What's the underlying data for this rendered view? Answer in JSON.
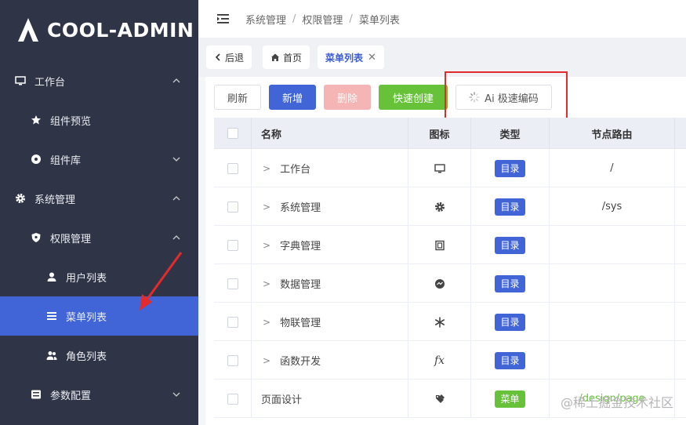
{
  "brand": {
    "name": "COOL-ADMIN"
  },
  "sidebar": {
    "items": [
      {
        "label": "工作台",
        "icon": "monitor-icon",
        "chevron": "up"
      },
      {
        "label": "组件预览",
        "icon": "star-icon"
      },
      {
        "label": "组件库",
        "icon": "disc-icon",
        "chevron": "down"
      },
      {
        "label": "系统管理",
        "icon": "gear-icon",
        "chevron": "up"
      },
      {
        "label": "权限管理",
        "icon": "shield-icon",
        "chevron": "up"
      },
      {
        "label": "用户列表",
        "icon": "user-icon"
      },
      {
        "label": "菜单列表",
        "icon": "menu-icon",
        "active": true
      },
      {
        "label": "角色列表",
        "icon": "users-icon"
      },
      {
        "label": "参数配置",
        "icon": "config-icon",
        "chevron": "down"
      }
    ]
  },
  "header": {
    "breadcrumb": [
      "系统管理",
      "权限管理",
      "菜单列表"
    ]
  },
  "tabs": {
    "back": "后退",
    "home": "首页",
    "current": "菜单列表"
  },
  "toolbar": {
    "refresh": "刷新",
    "add": "新增",
    "delete": "删除",
    "quick_create": "快速创建",
    "ai": "Ai 极速编码"
  },
  "table": {
    "columns": [
      "名称",
      "图标",
      "类型",
      "节点路由"
    ],
    "rows": [
      {
        "name": "工作台",
        "icon": "monitor-icon",
        "type": "目录",
        "route": "/",
        "expandable": true
      },
      {
        "name": "系统管理",
        "icon": "gear-icon",
        "type": "目录",
        "route": "/sys",
        "expandable": true
      },
      {
        "name": "字典管理",
        "icon": "dict-icon",
        "type": "目录",
        "route": "",
        "expandable": true
      },
      {
        "name": "数据管理",
        "icon": "chat-icon",
        "type": "目录",
        "route": "",
        "expandable": true
      },
      {
        "name": "物联管理",
        "icon": "asterisk-icon",
        "type": "目录",
        "route": "",
        "expandable": true
      },
      {
        "name": "函数开发",
        "icon": "fx-icon",
        "type": "目录",
        "route": "",
        "expandable": true
      },
      {
        "name": "页面设计",
        "icon": "design-icon",
        "type": "菜单",
        "route": "/design/page",
        "expandable": false
      }
    ]
  },
  "watermark": "@稀土掘金技术社区",
  "colors": {
    "sidebar_bg": "#2f3447",
    "primary": "#4165d7",
    "success": "#67c23a",
    "danger_light": "#f5b5b5",
    "highlight": "#e32b2b"
  }
}
